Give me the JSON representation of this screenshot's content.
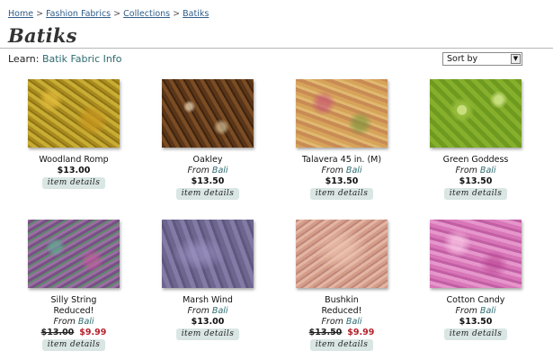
{
  "breadcrumb": {
    "items": [
      "Home",
      "Fashion Fabrics",
      "Collections",
      "Batiks"
    ],
    "separator": ">"
  },
  "page_title": "Batiks",
  "learn": {
    "label": "Learn:",
    "link": "Batik Fabric Info"
  },
  "sort": {
    "selected": "Sort by",
    "icon": "dropdown-arrow-icon"
  },
  "product_common": {
    "details_label": "item details",
    "from_prefix": "From"
  },
  "products": [
    {
      "name": "Woodland Romp",
      "price": "$13.00"
    },
    {
      "name": "Oakley",
      "brand": "Bali",
      "price": "$13.50"
    },
    {
      "name": "Talavera 45 in. (M)",
      "brand": "Bali",
      "price": "$13.50"
    },
    {
      "name": "Green Goddess",
      "brand": "Bali",
      "price": "$13.50"
    },
    {
      "name": "Silly String",
      "reduced": "Reduced!",
      "brand": "Bali",
      "old_price": "$13.00",
      "sale_price": "$9.99"
    },
    {
      "name": "Marsh Wind",
      "brand": "Bali",
      "price": "$13.00"
    },
    {
      "name": "Bushkin",
      "reduced": "Reduced!",
      "brand": "Bali",
      "old_price": "$13.50",
      "sale_price": "$9.99"
    },
    {
      "name": "Cotton Candy",
      "brand": "Bali",
      "price": "$13.50"
    }
  ],
  "colors": {
    "link": "#2f5d8a",
    "brand_link": "#2c6b70",
    "sale": "#b4222c",
    "details_button": "#d9e6e3"
  }
}
